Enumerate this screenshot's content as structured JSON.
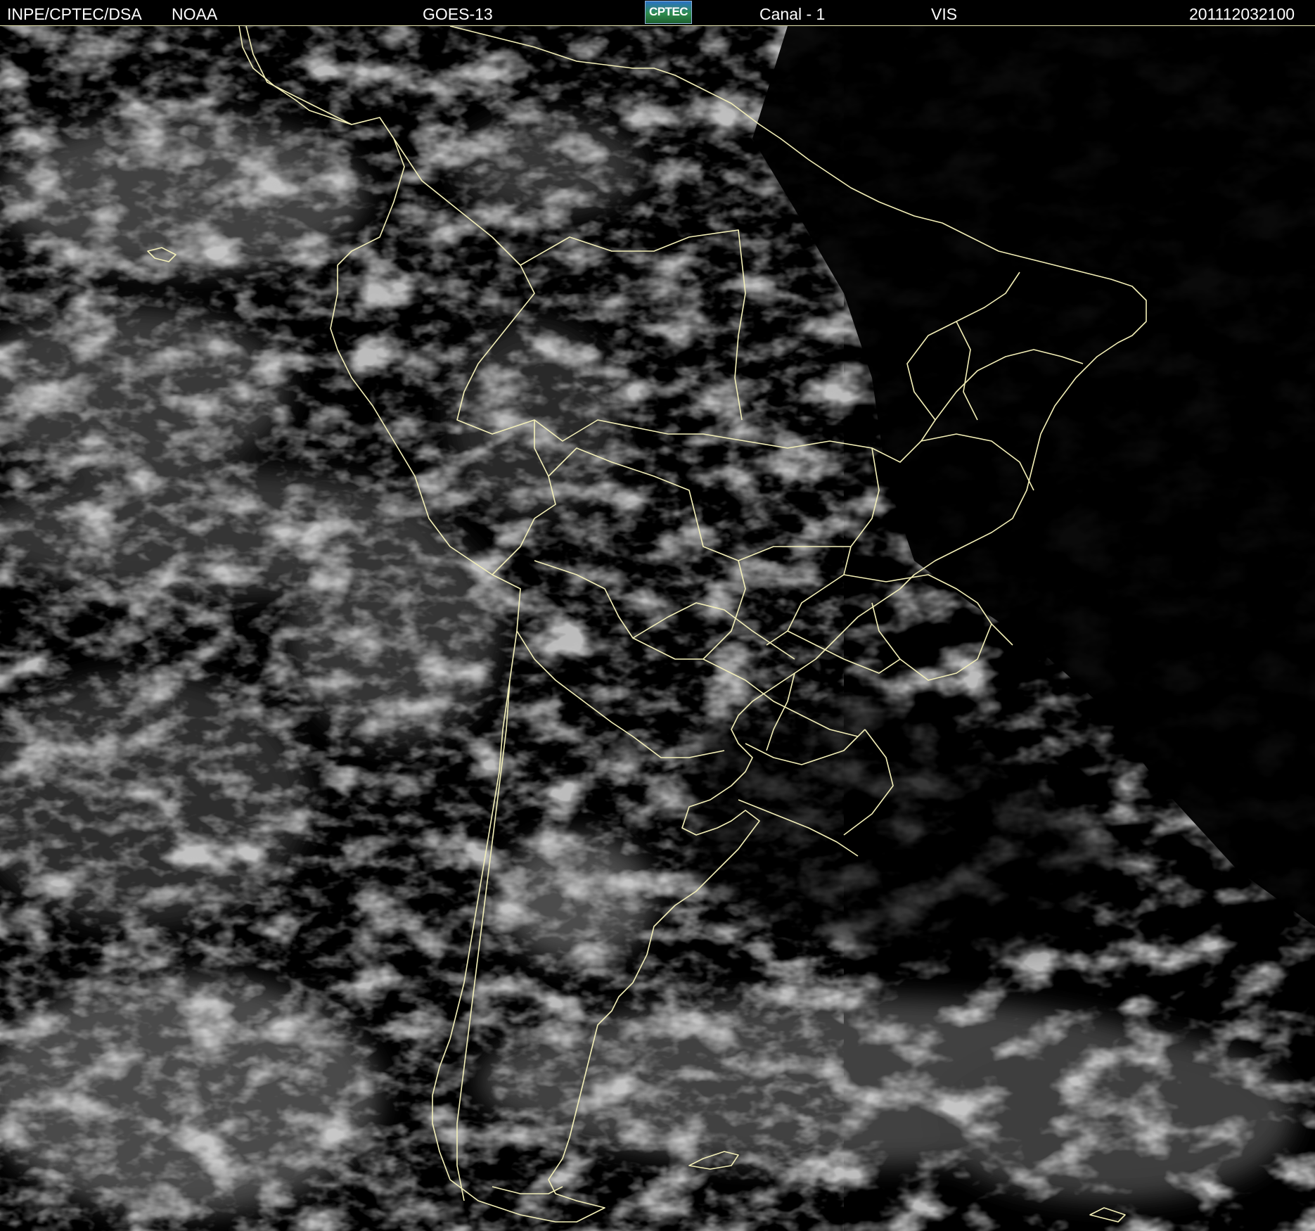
{
  "header": {
    "organization": "INPE/CPTEC/DSA",
    "agency": "NOAA",
    "satellite": "GOES-13",
    "logo_text": "CPTEC",
    "channel": "Canal - 1",
    "band": "VIS",
    "timestamp": "201112032100"
  },
  "colors": {
    "background": "#000000",
    "header_text": "#ffffff",
    "border_lines": "#f4f0b8",
    "cloud_light": "#b5b5b5",
    "cloud_dark": "#5a5a5a"
  },
  "icons": [
    "cptec-logo-icon"
  ]
}
